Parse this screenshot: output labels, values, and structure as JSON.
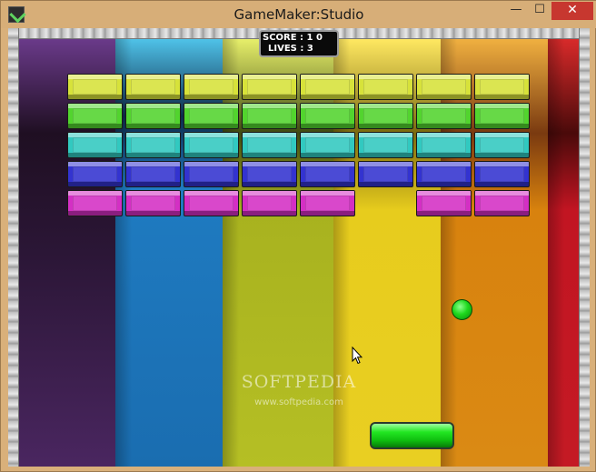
{
  "window": {
    "title": "GameMaker:Studio",
    "minimize_glyph": "—",
    "maximize_glyph": "☐",
    "close_glyph": "✕"
  },
  "hud": {
    "score_label": "SCORE : ",
    "score_value": "1 0",
    "lives_label": "LIVES : ",
    "lives_value": "3"
  },
  "bricks": {
    "colors": {
      "yellow": "#d7e23a",
      "green": "#52d42e",
      "cyan": "#31c9c0",
      "blue": "#3333d0",
      "magenta": "#d42fc4"
    },
    "rows": [
      {
        "color": "yellow",
        "present": [
          true,
          true,
          true,
          true,
          true,
          true,
          true,
          true
        ]
      },
      {
        "color": "green",
        "present": [
          true,
          true,
          true,
          true,
          true,
          true,
          true,
          true
        ]
      },
      {
        "color": "cyan",
        "present": [
          true,
          true,
          true,
          true,
          true,
          true,
          true,
          true
        ]
      },
      {
        "color": "blue",
        "present": [
          true,
          true,
          true,
          true,
          true,
          true,
          true,
          true
        ]
      },
      {
        "color": "magenta",
        "present": [
          true,
          true,
          true,
          true,
          true,
          false,
          true,
          true
        ]
      }
    ]
  },
  "ball": {
    "color": "#22d922"
  },
  "paddle": {
    "color": "#1ed91e"
  },
  "watermark": {
    "brand": "SOFTPEDIA",
    "url": "www.softpedia.com"
  }
}
